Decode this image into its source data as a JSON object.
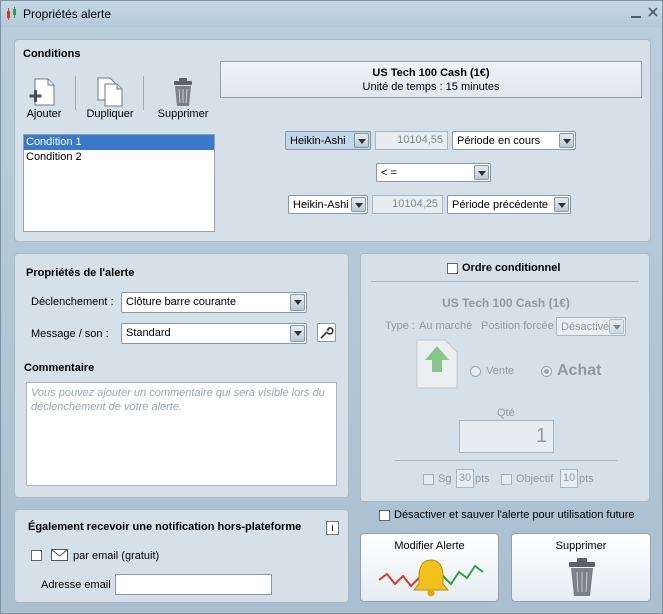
{
  "window": {
    "title": "Propriétés alerte"
  },
  "conditions": {
    "title": "Conditions",
    "toolbar": {
      "add": "Ajouter",
      "duplicate": "Dupliquer",
      "delete": "Supprimer"
    },
    "list": [
      "Condition 1",
      "Condition 2"
    ],
    "instrument": "US Tech 100 Cash (1€)",
    "timeframe": "Unité de temps : 15 minutes",
    "row1": {
      "indicator": "Heikin-Ashi",
      "value": "10104,55",
      "period": "Période en cours"
    },
    "operator": "< =",
    "row2": {
      "indicator": "Heikin-Ashi",
      "value": "10104,25",
      "period": "Période précédente"
    }
  },
  "alert_props": {
    "title": "Propriétés de l'alerte",
    "trigger_label": "Déclenchement :",
    "trigger_value": "Clôture barre courante",
    "sound_label": "Message / son :",
    "sound_value": "Standard",
    "comment_title": "Commentaire",
    "comment_placeholder": "Vous pouvez ajouter un commentaire qui sera visible lors du déclenchement de votre alerte."
  },
  "notify": {
    "title": "Également recevoir une notification hors-plateforme",
    "email_label": "par email (gratuit)",
    "address_label": "Adresse email",
    "address_value": ""
  },
  "order": {
    "title": "Ordre conditionnel",
    "instrument": "US Tech 100 Cash (1€)",
    "type_label": "Type :",
    "type_value": "Au marché",
    "forced_label": "Position forcée",
    "forced_value": "Désactivé",
    "sell": "Vente",
    "buy": "Achat",
    "qty_label": "Qté",
    "qty_value": "1",
    "sl_label": "Sg",
    "sl_value": "30",
    "sl_unit": "pts",
    "tp_label": "Objectif",
    "tp_value": "10",
    "tp_unit": "pts"
  },
  "disable_save": "Désactiver et sauver l'alerte pour utilisation future",
  "buttons": {
    "modify": "Modifier Alerte",
    "delete": "Supprimer"
  }
}
